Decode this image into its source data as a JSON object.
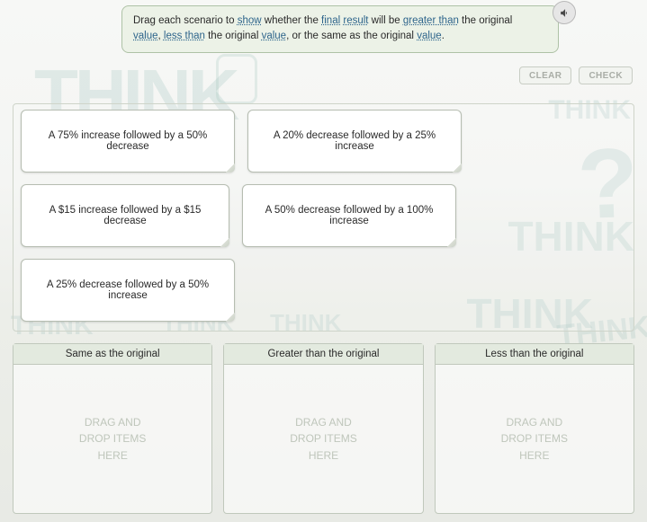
{
  "instruction": {
    "parts": [
      {
        "t": "Drag each scenario to "
      },
      {
        "t": "show",
        "kw": true
      },
      {
        "t": " whether the "
      },
      {
        "t": "final",
        "kw": true
      },
      {
        "t": " "
      },
      {
        "t": "result",
        "kw": true
      },
      {
        "t": " will be "
      },
      {
        "t": "greater than",
        "kw": true
      },
      {
        "t": " the original "
      },
      {
        "t": "value",
        "kw": true
      },
      {
        "t": ", "
      },
      {
        "t": "less than",
        "kw": true
      },
      {
        "t": " the original "
      },
      {
        "t": "value",
        "kw": true
      },
      {
        "t": ", or the same as the original "
      },
      {
        "t": "value",
        "kw": true
      },
      {
        "t": "."
      }
    ]
  },
  "buttons": {
    "clear": "CLEAR",
    "check": "CHECK"
  },
  "cards": [
    "A 75% increase followed by a 50% decrease",
    "A 20% decrease followed by a 25% increase",
    "A $15 increase followed by a $15 decrease",
    "A 50% decrease followed by a 100% increase",
    "A 25% decrease followed by a 50% increase"
  ],
  "zones": [
    {
      "title": "Same as the original",
      "placeholder": "DRAG AND DROP ITEMS HERE"
    },
    {
      "title": "Greater than the original",
      "placeholder": "DRAG AND DROP ITEMS HERE"
    },
    {
      "title": "Less than the original",
      "placeholder": "DRAG AND DROP ITEMS HERE"
    }
  ],
  "doodles": {
    "think": "THINK",
    "thinkShadow": "THINK",
    "question": "?"
  }
}
